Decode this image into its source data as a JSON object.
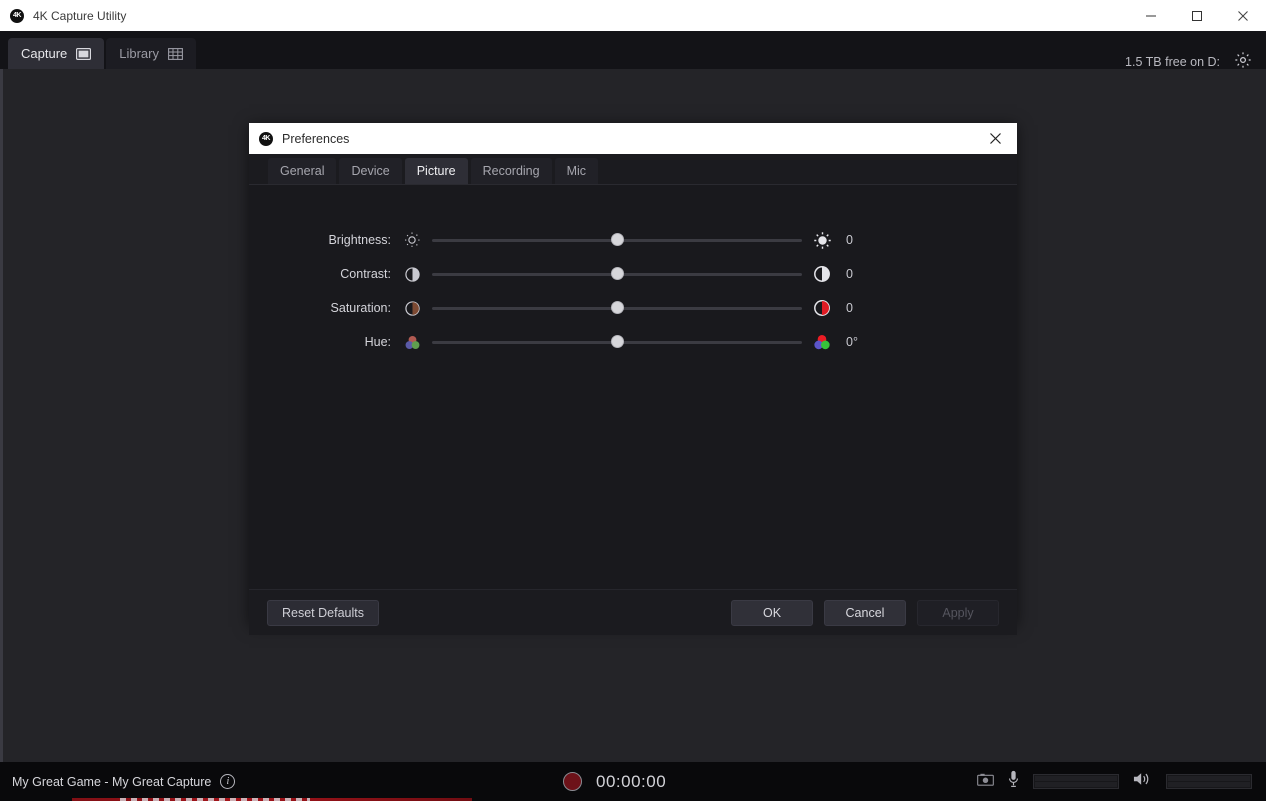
{
  "window": {
    "title": "4K Capture Utility",
    "logo_text": "4K",
    "minimize_label": "Minimize",
    "maximize_label": "Maximize",
    "close_label": "Close"
  },
  "toolbar": {
    "tabs": [
      {
        "label": "Capture",
        "icon": "monitor-icon",
        "active": true
      },
      {
        "label": "Library",
        "icon": "grid-icon",
        "active": false
      }
    ],
    "free_space": "1.5 TB free on D:",
    "settings_icon": "gear-icon"
  },
  "dialog": {
    "logo_text": "4K",
    "title": "Preferences",
    "close_label": "Close",
    "tabs": [
      {
        "label": "General",
        "active": false
      },
      {
        "label": "Device",
        "active": false
      },
      {
        "label": "Picture",
        "active": true
      },
      {
        "label": "Recording",
        "active": false
      },
      {
        "label": "Mic",
        "active": false
      }
    ],
    "settings": [
      {
        "label": "Brightness:",
        "value": "0",
        "position_pct": 50,
        "icon_low": "sun-outline-icon",
        "icon_high": "sun-filled-icon"
      },
      {
        "label": "Contrast:",
        "value": "0",
        "position_pct": 50,
        "icon_low": "contrast-low-icon",
        "icon_high": "contrast-high-icon"
      },
      {
        "label": "Saturation:",
        "value": "0",
        "position_pct": 50,
        "icon_low": "saturation-low-icon",
        "icon_high": "saturation-high-icon"
      },
      {
        "label": "Hue:",
        "value": "0°",
        "position_pct": 50,
        "icon_low": "hue-low-icon",
        "icon_high": "hue-high-icon"
      }
    ],
    "buttons": {
      "reset": "Reset Defaults",
      "ok": "OK",
      "cancel": "Cancel",
      "apply": "Apply"
    }
  },
  "statusbar": {
    "capture_title": "My Great Game - My Great Capture",
    "info_icon": "info-icon",
    "info_glyph": "i",
    "record_icon": "record-icon",
    "timer": "00:00:00",
    "snapshot_icon": "camera-icon",
    "mic_icon": "microphone-icon",
    "speaker_icon": "speaker-icon"
  },
  "colors": {
    "accent_red": "#b5151c",
    "panel": "#1b1b1f",
    "preview": "#242428",
    "knob": "#d6d6da"
  }
}
